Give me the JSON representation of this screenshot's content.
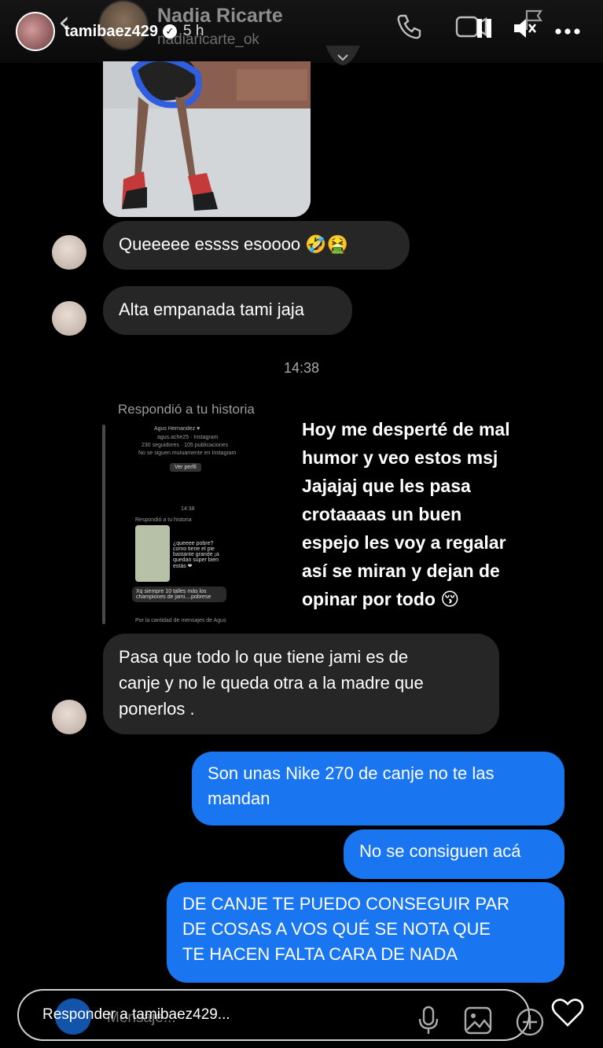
{
  "story_header": {
    "username": "tamibaez429",
    "time": "5 h"
  },
  "dm_header": {
    "name": "Nadia Ricarte",
    "handle": "nadiaricarte_ok"
  },
  "messages": {
    "m1": "Queeeee essss esoooo 🤣🤮",
    "m2": "Alta empanada tami jaja",
    "timestamp": "14:38",
    "reply_label": "Respondió a tu historia",
    "m3_line1": "Pasa que todo lo que tiene jami es de",
    "m3_line2": "canje y no le queda otra a la madre que",
    "m3_line3": "ponerlos .",
    "o1_line1": "Son unas Nike 270 de canje no te las",
    "o1_line2": "mandan",
    "o2": "No se consiguen acá",
    "o3_line1": "DE CANJE TE PUEDO CONSEGUIR PAR",
    "o3_line2": "DE COSAS A VOS QUÉ SE NOTA QUE",
    "o3_line3": "TE HACEN FALTA CARA DE NADA"
  },
  "story_thumb": {
    "name": "Agus Hernandez ♥",
    "handle": "agus.ache25 · Instagram",
    "stats": "230 seguidores · 105 publicaciones",
    "mutual": "No se siguen mutuamente en Instagram",
    "view_profile": "Ver perfil",
    "time": "14:38",
    "reply": "Respondió a tu historia",
    "q_text": "¿queeee pobre? como tiene el pie bastante grande ¡a quedan super bien estás ❤",
    "bubble": "Xq siempre 10 talles más los championes de jami....pobrese",
    "footer": "Por la cantidad de mensajes de Agus"
  },
  "story_caption": {
    "line1": "Hoy me desperté de mal",
    "line2": "humor y veo estos msj",
    "line3": "Jajajaj que les pasa",
    "line4": "crotaaaas un buen",
    "line5": "espejo les voy a regalar",
    "line6": "así se miran y dejan de",
    "line7": "opinar por todo 😚"
  },
  "reply_bar": {
    "placeholder": "Responder a tamibaez429...",
    "under_text": "Mensaje..."
  },
  "colors": {
    "outgoing": "#1976f0",
    "incoming": "#262626",
    "background": "#000000"
  }
}
